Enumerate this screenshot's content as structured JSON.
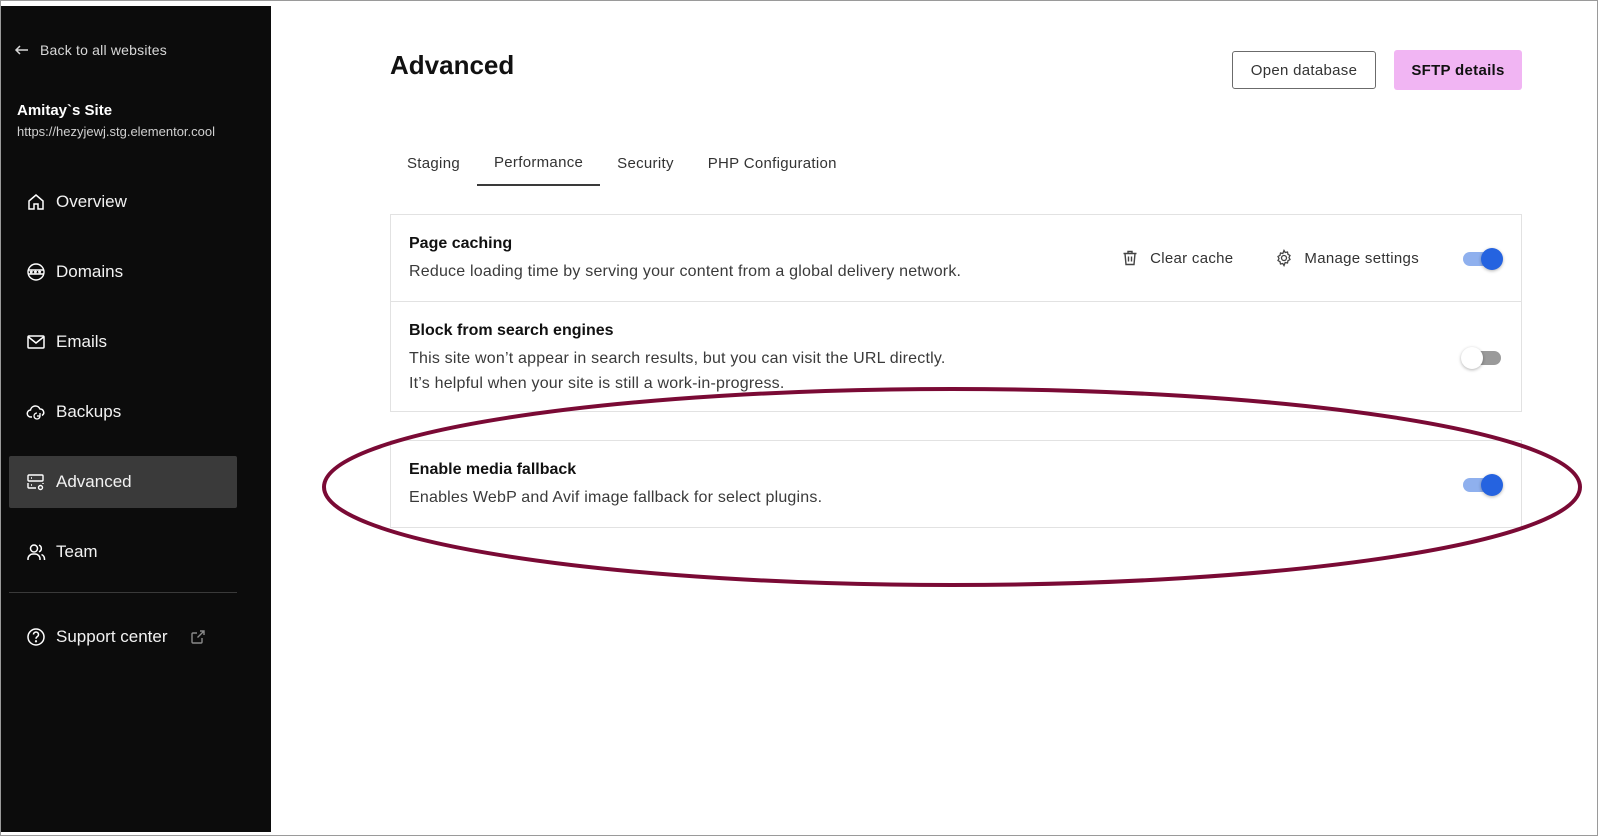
{
  "sidebar": {
    "back_label": "Back to all websites",
    "site_name": "Amitay`s Site",
    "site_url": "https://hezyjewj.stg.elementor.cool",
    "items": [
      {
        "label": "Overview",
        "icon": "home-icon",
        "active": false
      },
      {
        "label": "Domains",
        "icon": "globe-www-icon",
        "active": false
      },
      {
        "label": "Emails",
        "icon": "mail-icon",
        "active": false
      },
      {
        "label": "Backups",
        "icon": "cloud-backup-icon",
        "active": false
      },
      {
        "label": "Advanced",
        "icon": "server-settings-icon",
        "active": true
      },
      {
        "label": "Team",
        "icon": "users-icon",
        "active": false
      }
    ],
    "support_label": "Support center"
  },
  "header": {
    "title": "Advanced",
    "open_db_label": "Open database",
    "sftp_label": "SFTP details"
  },
  "tabs": [
    {
      "label": "Staging",
      "active": false
    },
    {
      "label": "Performance",
      "active": true
    },
    {
      "label": "Security",
      "active": false
    },
    {
      "label": "PHP Configuration",
      "active": false
    }
  ],
  "settings": {
    "page_caching": {
      "title": "Page caching",
      "description": "Reduce loading time by serving your content from a global delivery network.",
      "clear_cache_label": "Clear cache",
      "manage_settings_label": "Manage settings",
      "enabled": true
    },
    "block_search": {
      "title": "Block from search engines",
      "description_line1": "This site won’t appear in search results, but you can visit the URL directly.",
      "description_line2": "It’s helpful when your site is still a work-in-progress.",
      "enabled": false
    },
    "media_fallback": {
      "title": "Enable media fallback",
      "description": "Enables WebP and Avif image fallback for select plugins.",
      "enabled": true
    }
  },
  "colors": {
    "sidebar_bg": "#0c0c0c",
    "accent_pink": "#f1b5f3",
    "toggle_on": "#2563e0",
    "annotation": "#7a0a35"
  }
}
